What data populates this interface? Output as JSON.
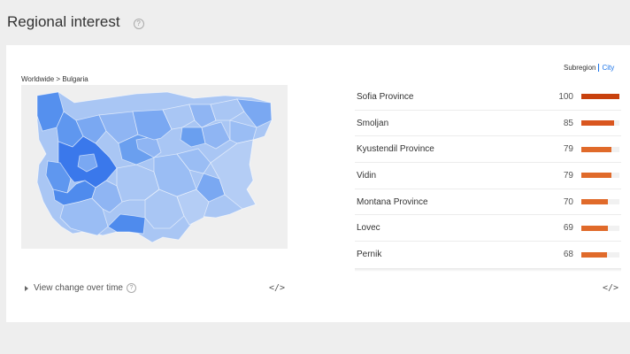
{
  "header": {
    "title": "Regional interest",
    "help": "?"
  },
  "map": {
    "breadcrumb": "Worldwide > Bulgaria",
    "colors": {
      "background": "#efefef",
      "light": "#a9c6f4",
      "mid": "#7aa8f2",
      "strong": "#5590ee",
      "darkest": "#3a78eb"
    }
  },
  "footer": {
    "view_change_label": "View change over time",
    "help": "?",
    "embed_label": "</>"
  },
  "toggle": {
    "subregion": "Subregion",
    "city": "City"
  },
  "regions": {
    "bar_color": "#d9561f",
    "rows": [
      {
        "name": "Sofia Province",
        "value": "100",
        "pct": 100,
        "color": "#c8410d"
      },
      {
        "name": "Smoljan",
        "value": "85",
        "pct": 85,
        "color": "#d9561f"
      },
      {
        "name": "Kyustendil Province",
        "value": "79",
        "pct": 79,
        "color": "#e06a2a"
      },
      {
        "name": "Vidin",
        "value": "79",
        "pct": 79,
        "color": "#e06a2a"
      },
      {
        "name": "Montana Province",
        "value": "70",
        "pct": 70,
        "color": "#e06a2a"
      },
      {
        "name": "Lovec",
        "value": "69",
        "pct": 69,
        "color": "#e06a2a"
      },
      {
        "name": "Pernik",
        "value": "68",
        "pct": 68,
        "color": "#e06a2a"
      }
    ]
  }
}
